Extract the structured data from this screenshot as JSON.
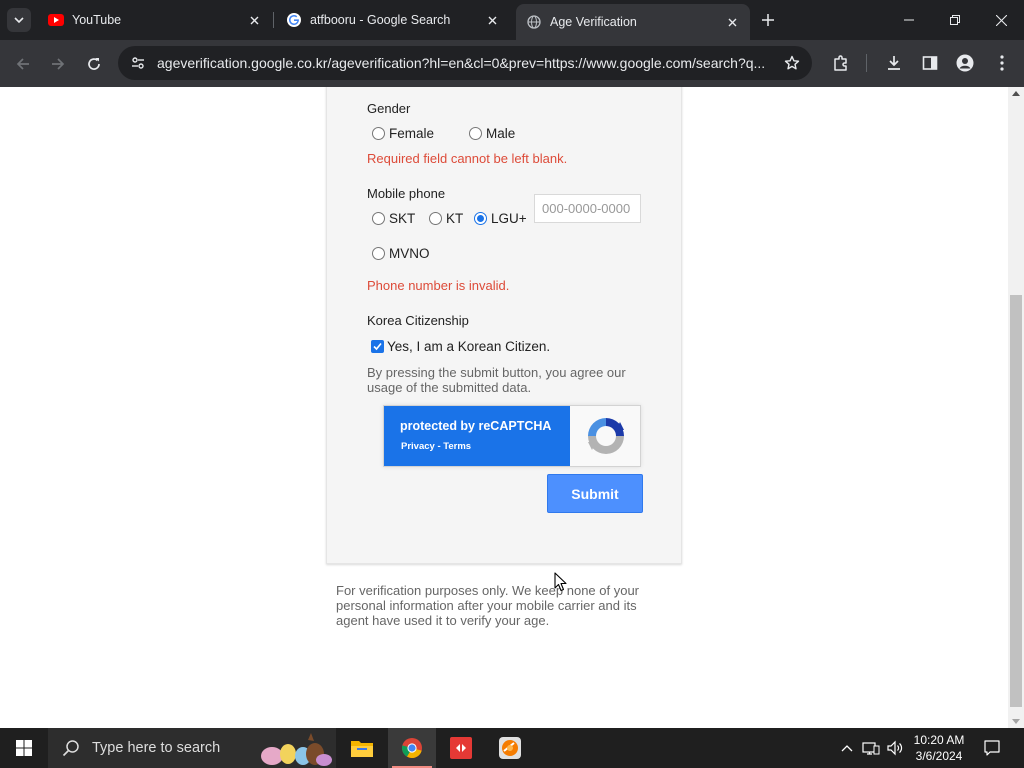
{
  "browser": {
    "tabs": [
      {
        "title": "YouTube",
        "favicon": "youtube-icon",
        "active": false
      },
      {
        "title": "atfbooru - Google Search",
        "favicon": "google-icon",
        "active": false
      },
      {
        "title": "Age Verification",
        "favicon": "globe-icon",
        "active": true
      }
    ],
    "url": "ageverification.google.co.kr/ageverification?hl=en&cl=0&prev=https://www.google.com/search?q..."
  },
  "form": {
    "gender": {
      "label": "Gender",
      "options": [
        "Female",
        "Male"
      ],
      "error": "Required field cannot be left blank."
    },
    "mobile": {
      "label": "Mobile phone",
      "carriers": [
        "SKT",
        "KT",
        "LGU+",
        "MVNO"
      ],
      "selected": "LGU+",
      "placeholder": "000-0000-0000",
      "value": "",
      "error": "Phone number is invalid."
    },
    "citizenship": {
      "label": "Korea Citizenship",
      "checkbox_label": "Yes, I am a Korean Citizen.",
      "checked": true
    },
    "agree_text": "By pressing the submit button, you agree our usage of the submitted data.",
    "recaptcha": {
      "title": "protected by reCAPTCHA",
      "privacy": "Privacy",
      "separator": " - ",
      "terms": "Terms"
    },
    "submit_label": "Submit"
  },
  "footnote": "For verification purposes only. We keep none of your personal information after your mobile carrier and its agent have used it to verify your age.",
  "taskbar": {
    "search_placeholder": "Type here to search",
    "time": "10:20 AM",
    "date": "3/6/2024"
  },
  "colors": {
    "error": "#dd4b39",
    "accent": "#1a73e8",
    "submit": "#4d90fe"
  }
}
